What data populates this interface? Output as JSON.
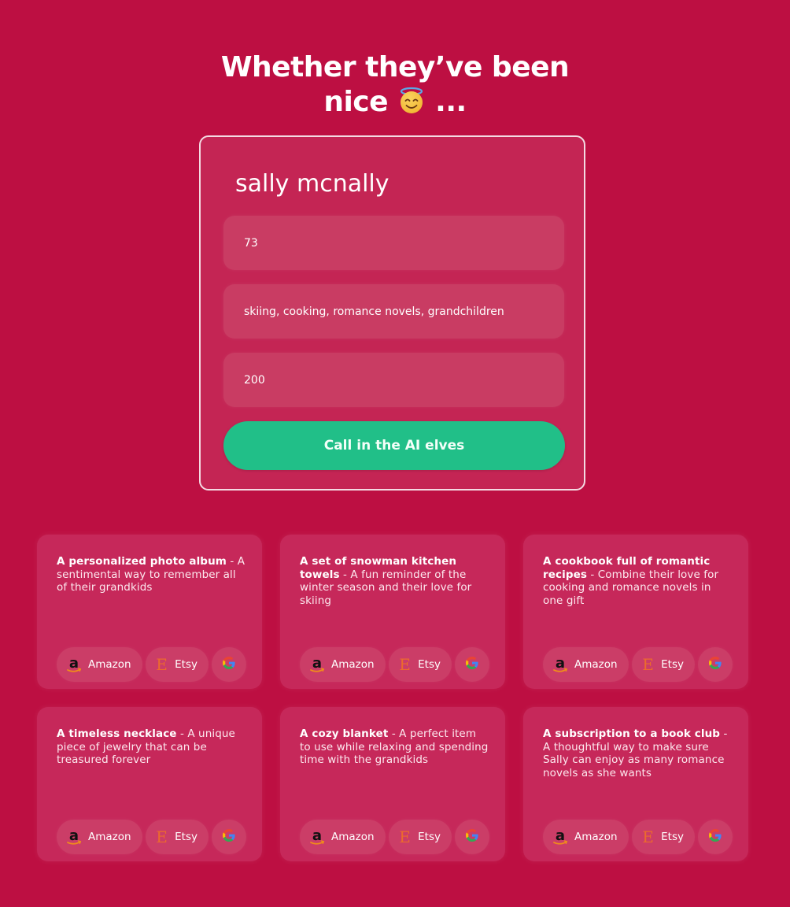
{
  "header": {
    "title_line1": "Whether they’ve been",
    "title_line2_text": "nice",
    "title_emoji": "smiling-face-with-halo-icon",
    "title_ellipsis": "..."
  },
  "form": {
    "name_value": "sally mcnally",
    "age_value": "73",
    "interests_value": "skiing, cooking, romance novels, grandchildren",
    "budget_value": "200",
    "submit_label": "Call in the AI elves"
  },
  "stores": {
    "amazon_label": "Amazon",
    "etsy_label": "Etsy",
    "google_label": ""
  },
  "colors": {
    "background": "#bd0f42",
    "card": "#c42554",
    "button": "#21bf88",
    "etsy": "#ec6a2c"
  },
  "results": [
    {
      "title": "A personalized photo album",
      "description": " - A sentimental way to remember all of their grandkids"
    },
    {
      "title": "A set of snowman kitchen towels",
      "description": " - A fun reminder of the winter season and their love for skiing"
    },
    {
      "title": "A cookbook full of romantic recipes",
      "description": " - Combine their love for cooking and romance novels in one gift"
    },
    {
      "title": "A timeless necklace",
      "description": " - A unique piece of jewelry that can be treasured forever"
    },
    {
      "title": "A cozy blanket",
      "description": " - A perfect item to use while relaxing and spending time with the grandkids"
    },
    {
      "title": "A subscription to a book club",
      "description": " - A thoughtful way to make sure Sally can enjoy as many romance novels as she wants"
    }
  ]
}
